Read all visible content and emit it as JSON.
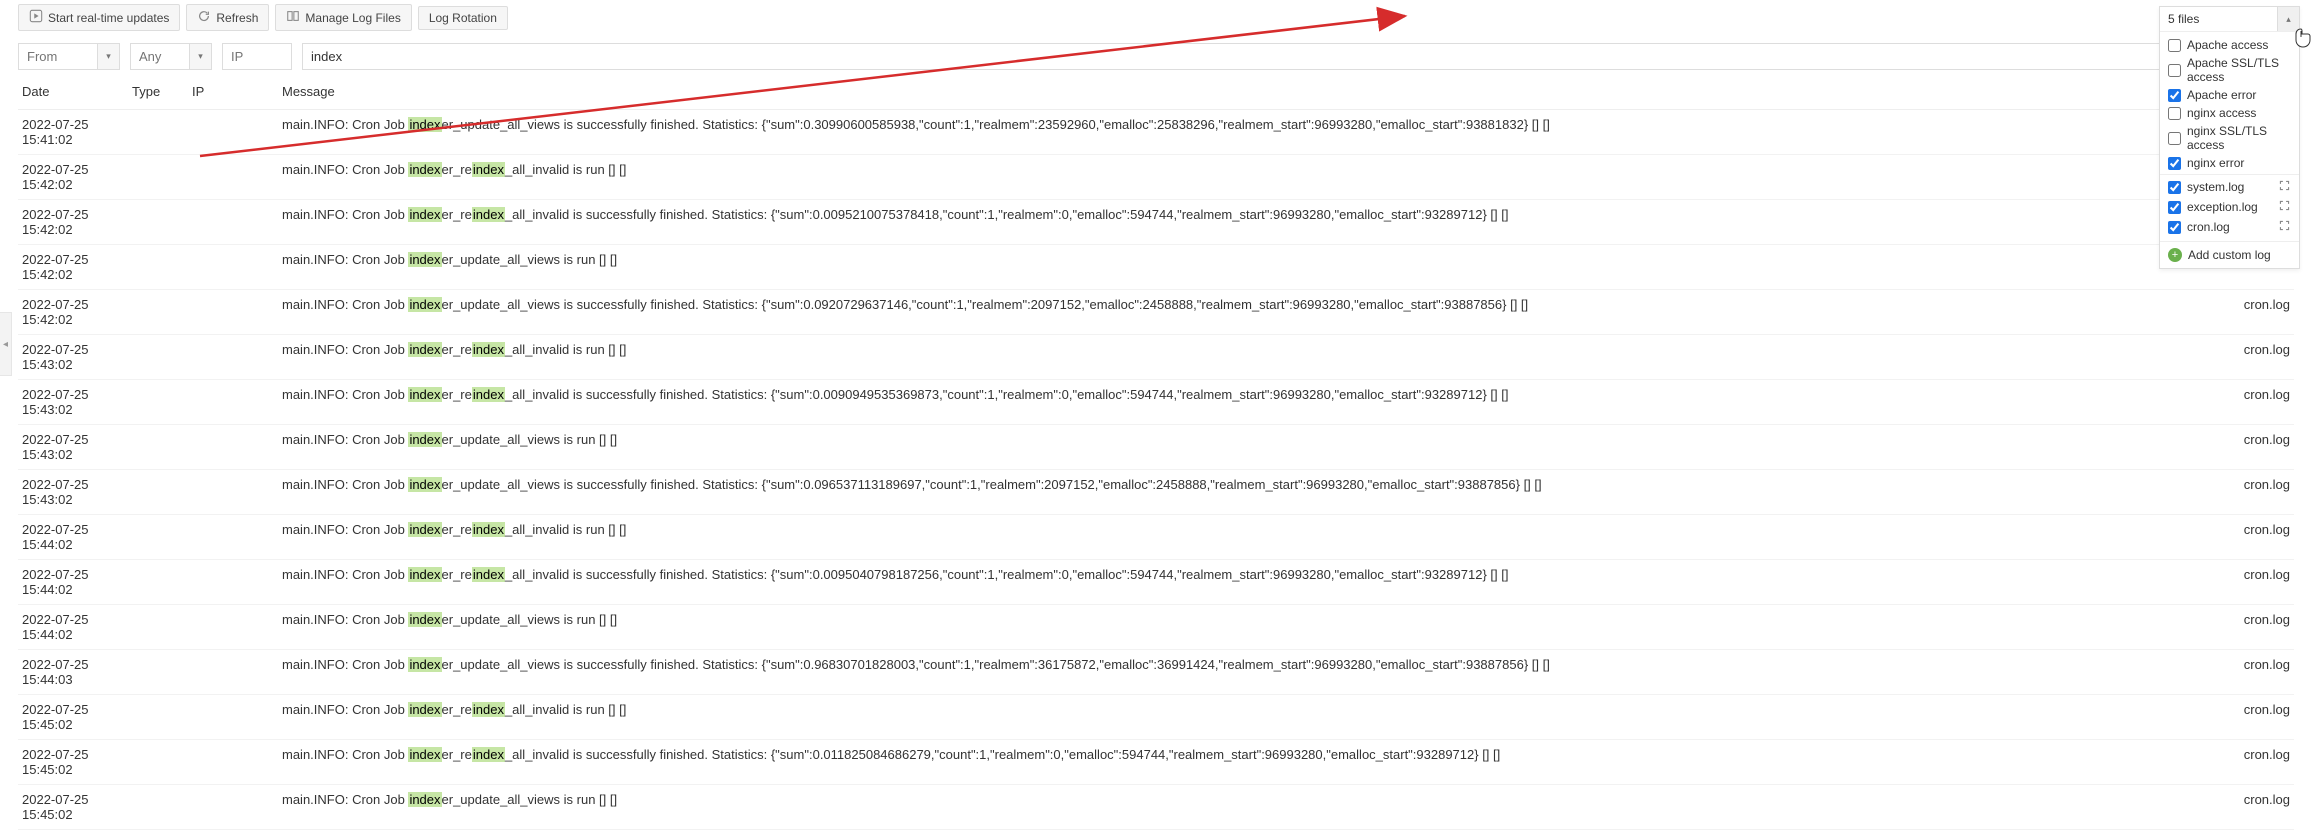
{
  "toolbar": {
    "start": "Start real-time updates",
    "refresh": "Refresh",
    "manage": "Manage Log Files",
    "rotation": "Log Rotation"
  },
  "filters": {
    "from_placeholder": "From",
    "any_placeholder": "Any",
    "ip_placeholder": "IP",
    "search_value": "index"
  },
  "columns": {
    "date": "Date",
    "type": "Type",
    "ip": "IP",
    "message": "Message",
    "file": ""
  },
  "highlight": "index",
  "rows": [
    {
      "date": "2022-07-25 15:41:02",
      "type": "",
      "ip": "",
      "message": "main.INFO: Cron Job indexer_update_all_views is successfully finished. Statistics: {\"sum\":0.30990600585938,\"count\":1,\"realmem\":23592960,\"emalloc\":25838296,\"realmem_start\":96993280,\"emalloc_start\":93881832} [] []",
      "file": ""
    },
    {
      "date": "2022-07-25 15:42:02",
      "type": "",
      "ip": "",
      "message": "main.INFO: Cron Job indexer_reindex_all_invalid is run [] []",
      "file": ""
    },
    {
      "date": "2022-07-25 15:42:02",
      "type": "",
      "ip": "",
      "message": "main.INFO: Cron Job indexer_reindex_all_invalid is successfully finished. Statistics: {\"sum\":0.0095210075378418,\"count\":1,\"realmem\":0,\"emalloc\":594744,\"realmem_start\":96993280,\"emalloc_start\":93289712} [] []",
      "file": ""
    },
    {
      "date": "2022-07-25 15:42:02",
      "type": "",
      "ip": "",
      "message": "main.INFO: Cron Job indexer_update_all_views is run [] []",
      "file": ""
    },
    {
      "date": "2022-07-25 15:42:02",
      "type": "",
      "ip": "",
      "message": "main.INFO: Cron Job indexer_update_all_views is successfully finished. Statistics: {\"sum\":0.0920729637146,\"count\":1,\"realmem\":2097152,\"emalloc\":2458888,\"realmem_start\":96993280,\"emalloc_start\":93887856} [] []",
      "file": "cron.log"
    },
    {
      "date": "2022-07-25 15:43:02",
      "type": "",
      "ip": "",
      "message": "main.INFO: Cron Job indexer_reindex_all_invalid is run [] []",
      "file": "cron.log"
    },
    {
      "date": "2022-07-25 15:43:02",
      "type": "",
      "ip": "",
      "message": "main.INFO: Cron Job indexer_reindex_all_invalid is successfully finished. Statistics: {\"sum\":0.0090949535369873,\"count\":1,\"realmem\":0,\"emalloc\":594744,\"realmem_start\":96993280,\"emalloc_start\":93289712} [] []",
      "file": "cron.log"
    },
    {
      "date": "2022-07-25 15:43:02",
      "type": "",
      "ip": "",
      "message": "main.INFO: Cron Job indexer_update_all_views is run [] []",
      "file": "cron.log"
    },
    {
      "date": "2022-07-25 15:43:02",
      "type": "",
      "ip": "",
      "message": "main.INFO: Cron Job indexer_update_all_views is successfully finished. Statistics: {\"sum\":0.096537113189697,\"count\":1,\"realmem\":2097152,\"emalloc\":2458888,\"realmem_start\":96993280,\"emalloc_start\":93887856} [] []",
      "file": "cron.log"
    },
    {
      "date": "2022-07-25 15:44:02",
      "type": "",
      "ip": "",
      "message": "main.INFO: Cron Job indexer_reindex_all_invalid is run [] []",
      "file": "cron.log"
    },
    {
      "date": "2022-07-25 15:44:02",
      "type": "",
      "ip": "",
      "message": "main.INFO: Cron Job indexer_reindex_all_invalid is successfully finished. Statistics: {\"sum\":0.0095040798187256,\"count\":1,\"realmem\":0,\"emalloc\":594744,\"realmem_start\":96993280,\"emalloc_start\":93289712} [] []",
      "file": "cron.log"
    },
    {
      "date": "2022-07-25 15:44:02",
      "type": "",
      "ip": "",
      "message": "main.INFO: Cron Job indexer_update_all_views is run [] []",
      "file": "cron.log"
    },
    {
      "date": "2022-07-25 15:44:03",
      "type": "",
      "ip": "",
      "message": "main.INFO: Cron Job indexer_update_all_views is successfully finished. Statistics: {\"sum\":0.96830701828003,\"count\":1,\"realmem\":36175872,\"emalloc\":36991424,\"realmem_start\":96993280,\"emalloc_start\":93887856} [] []",
      "file": "cron.log"
    },
    {
      "date": "2022-07-25 15:45:02",
      "type": "",
      "ip": "",
      "message": "main.INFO: Cron Job indexer_reindex_all_invalid is run [] []",
      "file": "cron.log"
    },
    {
      "date": "2022-07-25 15:45:02",
      "type": "",
      "ip": "",
      "message": "main.INFO: Cron Job indexer_reindex_all_invalid is successfully finished. Statistics: {\"sum\":0.011825084686279,\"count\":1,\"realmem\":0,\"emalloc\":594744,\"realmem_start\":96993280,\"emalloc_start\":93289712} [] []",
      "file": "cron.log"
    },
    {
      "date": "2022-07-25 15:45:02",
      "type": "",
      "ip": "",
      "message": "main.INFO: Cron Job indexer_update_all_views is run [] []",
      "file": "cron.log"
    }
  ],
  "files_dropdown": {
    "summary": "5 files",
    "groups": [
      [
        {
          "label": "Apache access",
          "checked": false,
          "expandable": false
        },
        {
          "label": "Apache SSL/TLS access",
          "checked": false,
          "expandable": false
        },
        {
          "label": "Apache error",
          "checked": true,
          "expandable": false
        },
        {
          "label": "nginx access",
          "checked": false,
          "expandable": false
        },
        {
          "label": "nginx SSL/TLS access",
          "checked": false,
          "expandable": false
        },
        {
          "label": "nginx error",
          "checked": true,
          "expandable": false
        }
      ],
      [
        {
          "label": "system.log",
          "checked": true,
          "expandable": true
        },
        {
          "label": "exception.log",
          "checked": true,
          "expandable": true
        },
        {
          "label": "cron.log",
          "checked": true,
          "expandable": true
        }
      ]
    ],
    "add_label": "Add custom log"
  }
}
